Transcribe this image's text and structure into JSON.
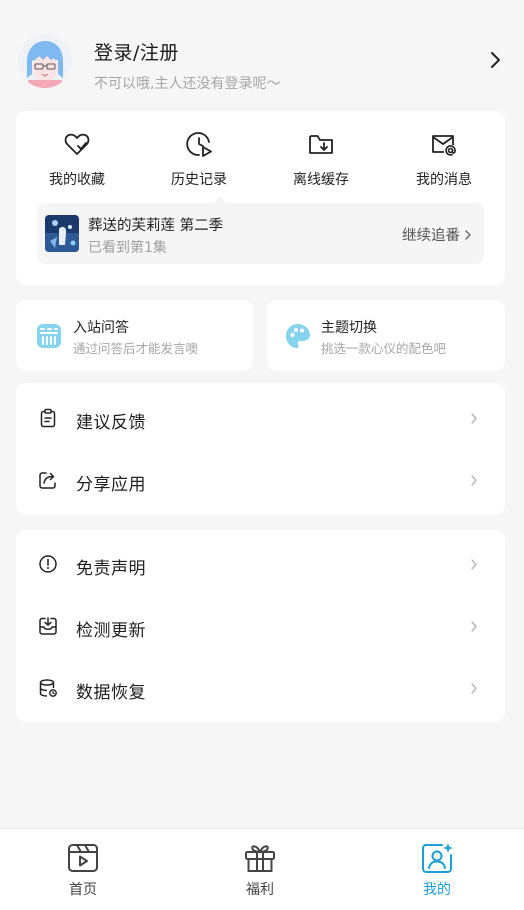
{
  "profile": {
    "title": "登录/注册",
    "subtitle": "不可以哦,主人还没有登录呢～"
  },
  "quick_actions": [
    {
      "label": "我的收藏",
      "icon": "heart-check-icon"
    },
    {
      "label": "历史记录",
      "icon": "history-play-icon"
    },
    {
      "label": "离线缓存",
      "icon": "folder-download-icon"
    },
    {
      "label": "我的消息",
      "icon": "mail-at-icon"
    }
  ],
  "continue_watching": {
    "title": "葬送的芙莉莲 第二季",
    "progress": "已看到第1集",
    "action": "继续追番"
  },
  "features": [
    {
      "title": "入站问答",
      "subtitle": "通过问答后才能发言噢",
      "icon": "quiz-icon"
    },
    {
      "title": "主题切换",
      "subtitle": "挑选一款心仪的配色吧",
      "icon": "palette-icon"
    }
  ],
  "menu_group_1": [
    {
      "label": "建议反馈",
      "icon": "clipboard-icon"
    },
    {
      "label": "分享应用",
      "icon": "share-icon"
    }
  ],
  "menu_group_2": [
    {
      "label": "免责声明",
      "icon": "exclamation-circle-icon"
    },
    {
      "label": "检测更新",
      "icon": "inbox-download-icon"
    },
    {
      "label": "数据恢复",
      "icon": "database-restore-icon"
    }
  ],
  "tabbar": [
    {
      "label": "首页",
      "icon": "video-clapper-icon",
      "active": false
    },
    {
      "label": "福利",
      "icon": "gift-icon",
      "active": false
    },
    {
      "label": "我的",
      "icon": "user-sparkle-icon",
      "active": true
    }
  ],
  "colors": {
    "accent": "#1aa0d6",
    "background": "#f6f6f7",
    "card": "#ffffff",
    "feature_icon": "#86d3ee"
  }
}
